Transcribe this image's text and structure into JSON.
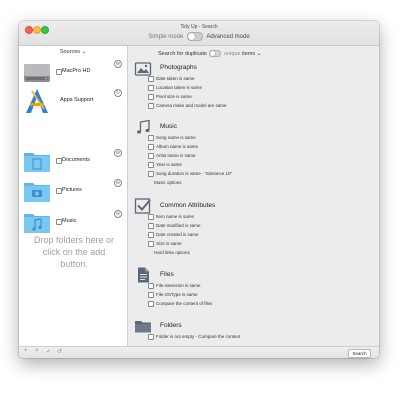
{
  "window": {
    "title": "Tidy Up - Search",
    "mode_simple": "Simple mode",
    "mode_advanced": "Advanced mode"
  },
  "sidebar": {
    "header": "Sources",
    "header_chevron": "⌄",
    "sources": [
      {
        "label": "MacPro HD",
        "icon": "hard-drive-icon",
        "checkbox": true,
        "action": "⊖"
      },
      {
        "label": "Apps Support",
        "icon": "applications-folder-icon",
        "checkbox": false,
        "action": "↻"
      },
      {
        "label": "Documents",
        "icon": "documents-folder-icon",
        "checkbox": true,
        "action": "⊖"
      },
      {
        "label": "Pictures",
        "icon": "pictures-folder-icon",
        "checkbox": true,
        "action": "⊖"
      },
      {
        "label": "Music",
        "icon": "music-folder-icon",
        "checkbox": true,
        "action": "⊖"
      }
    ],
    "drop_hint": "Drop folders here or click on the add button."
  },
  "search": {
    "prefix": "Search for duplicate",
    "toggle_label": "unique",
    "suffix": "items",
    "suffix_chevron": "⌄"
  },
  "sections": {
    "photographs": {
      "title": "Photographs",
      "icon": "photo-icon",
      "options": [
        "Date taken is same",
        "Location taken is same",
        "Pixel size is same",
        "Camera make and model are same"
      ]
    },
    "music": {
      "title": "Music",
      "icon": "music-note-icon",
      "options": [
        "Song name is same",
        "Album name is same",
        "Artist name is same",
        "Year is same",
        "Song duration is same - Tolerance 10\""
      ],
      "extra": "Music options"
    },
    "common": {
      "title": "Common Attributes",
      "icon": "checkmark-box-icon",
      "options": [
        "Item name is same",
        "Date modified is same",
        "Date created is same",
        "Size is same"
      ],
      "extra": "Hard links options"
    },
    "files": {
      "title": "Files",
      "icon": "document-icon",
      "options": [
        "File extension is same",
        "File OSType is same",
        "Compare the content of files"
      ]
    },
    "folders": {
      "title": "Folders",
      "icon": "folder-icon",
      "options": [
        "Folder is not empty - Compare the content"
      ]
    }
  },
  "bottom_bar": {
    "add": "+",
    "remove": "×",
    "confirm": "✓",
    "reset": "↺",
    "search_button": "Search"
  }
}
